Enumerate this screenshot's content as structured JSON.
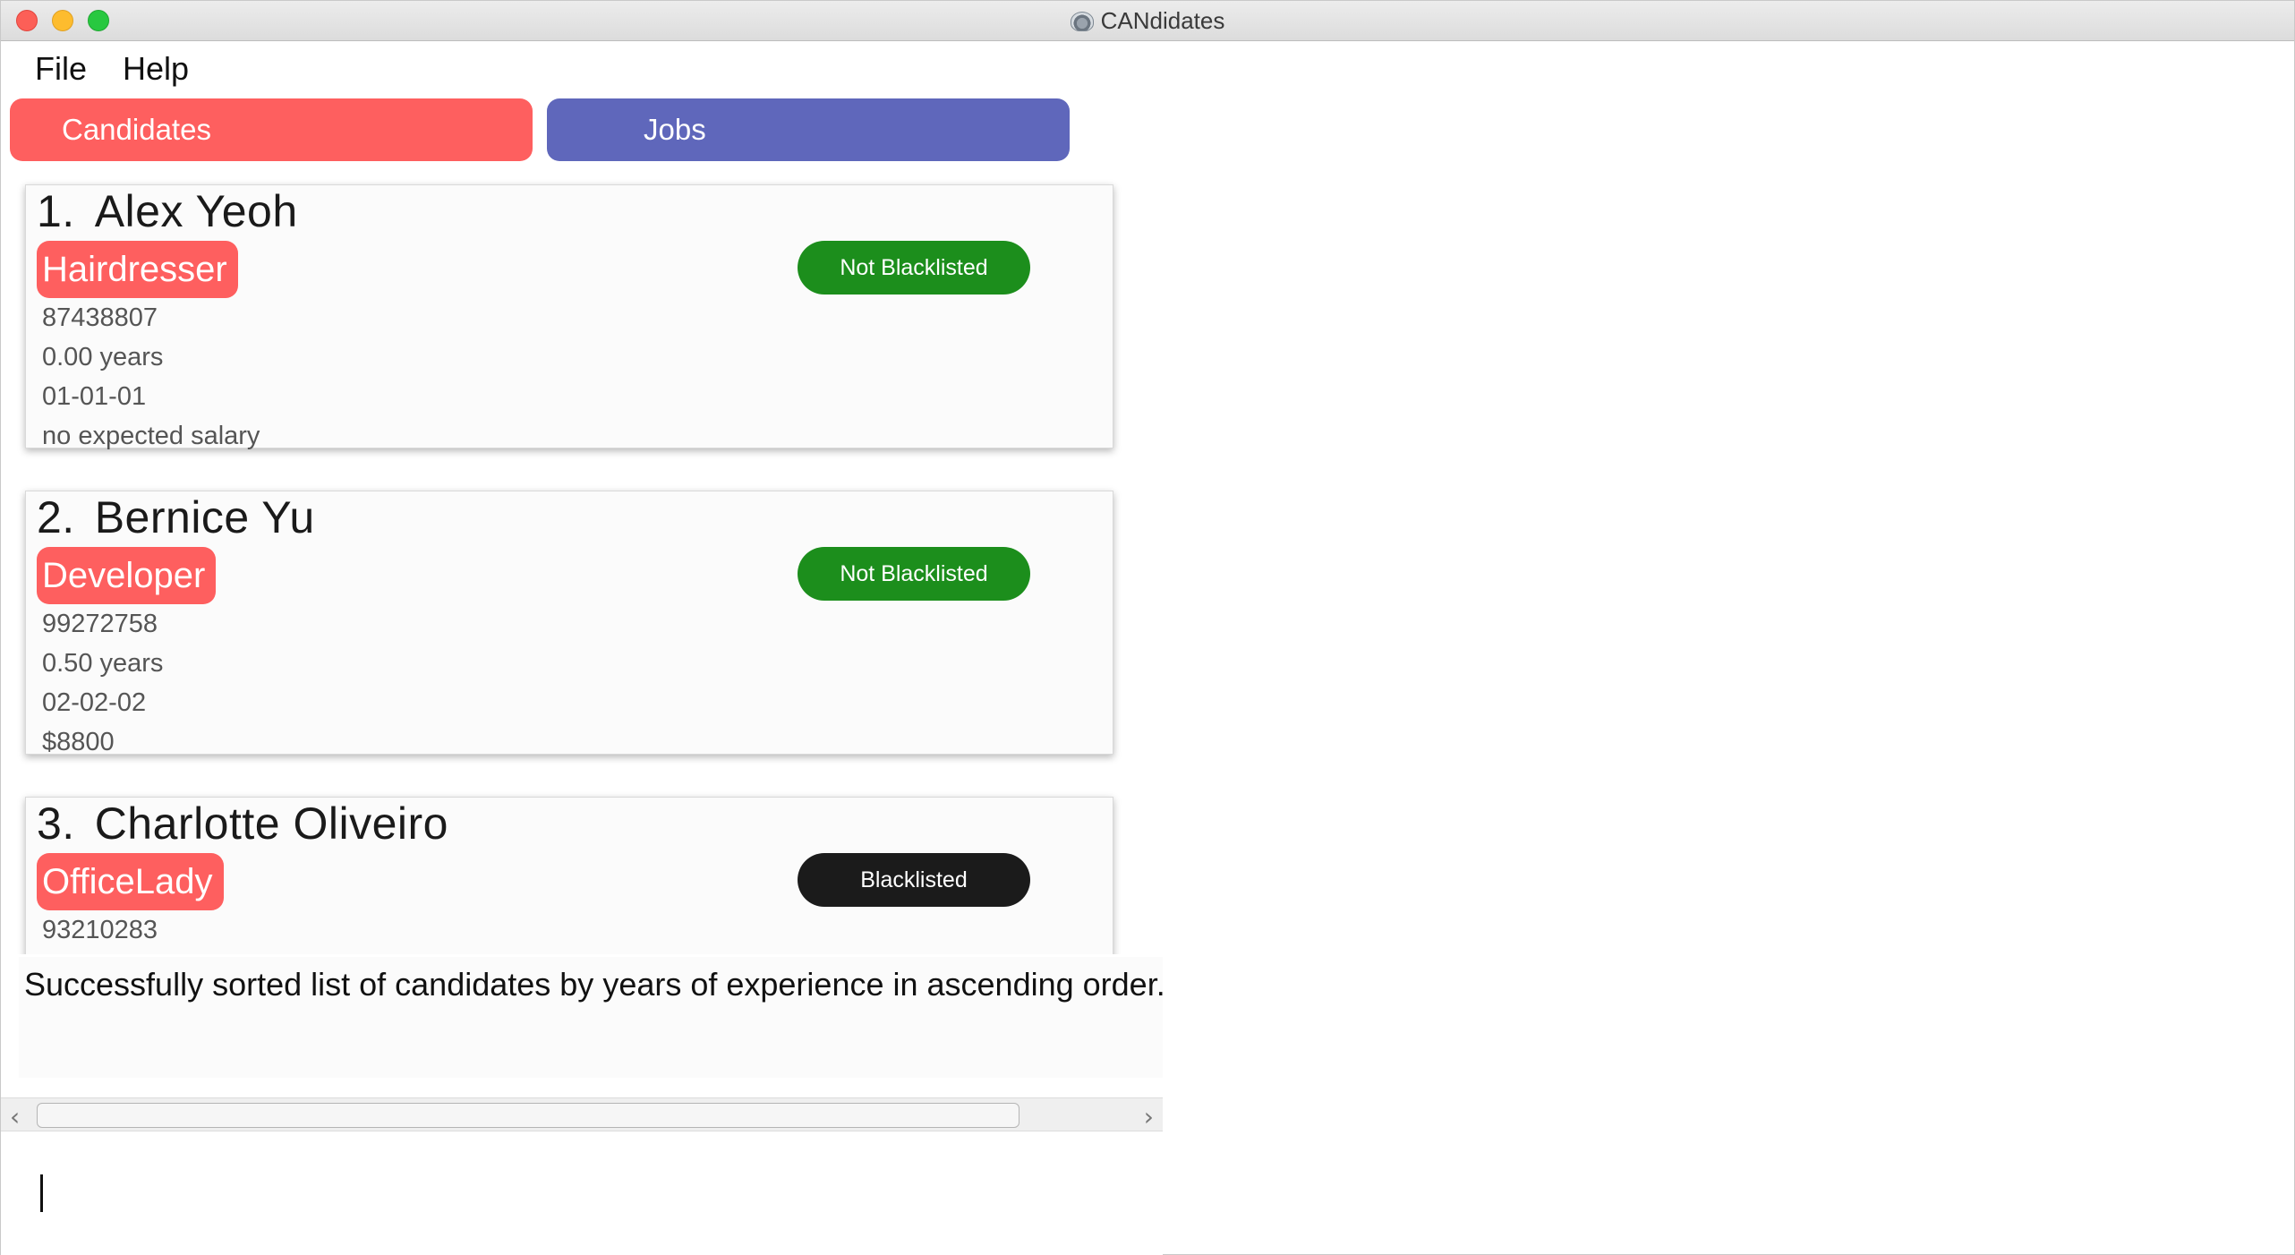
{
  "window": {
    "title": "CANdidates",
    "app_icon": "app-icon"
  },
  "menu": {
    "items": [
      {
        "label": "File"
      },
      {
        "label": "Help"
      }
    ]
  },
  "tabs": {
    "candidates": {
      "label": "Candidates",
      "color": "#fe5f5f"
    },
    "jobs": {
      "label": "Jobs",
      "color": "#5f67bb"
    }
  },
  "candidates": [
    {
      "index": "1.",
      "name": "Alex Yeoh",
      "role": "Hairdresser",
      "status": "Not Blacklisted",
      "status_color": "#1c8e1c",
      "phone": "87438807",
      "experience": "0.00 years",
      "date": "01-01-01",
      "salary": "no expected salary"
    },
    {
      "index": "2.",
      "name": "Bernice Yu",
      "role": "Developer",
      "status": "Not Blacklisted",
      "status_color": "#1c8e1c",
      "phone": "99272758",
      "experience": "0.50 years",
      "date": "02-02-02",
      "salary": "$8800"
    },
    {
      "index": "3.",
      "name": "Charlotte Oliveiro",
      "role": "OfficeLady",
      "status": "Blacklisted",
      "status_color": "#1b1b1b",
      "phone": "93210283"
    }
  ],
  "result": {
    "message": "Successfully sorted list of candidates by years of experience in ascending order."
  },
  "scrollbar": {
    "left_icon": "chevron-left-icon",
    "right_icon": "chevron-right-icon"
  },
  "command": {
    "value": "",
    "placeholder": ""
  }
}
